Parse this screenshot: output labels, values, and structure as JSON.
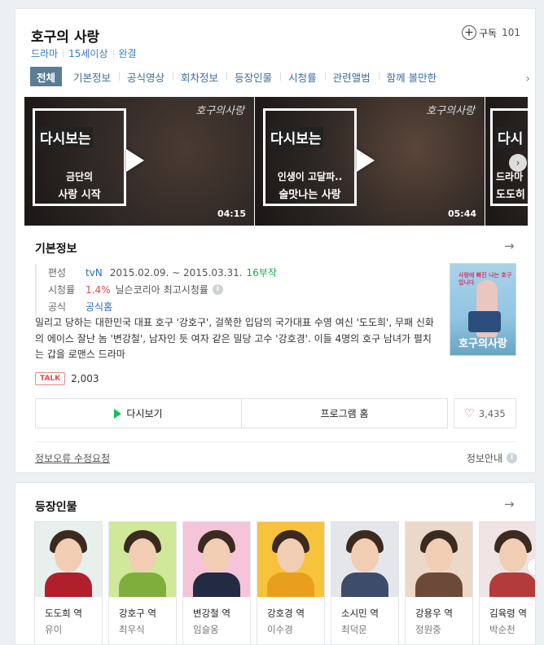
{
  "header": {
    "title": "호구의 사랑",
    "meta": [
      "드라마",
      "15세이상",
      "완결"
    ],
    "subscribe_label": "구독",
    "subscribe_count": "101"
  },
  "tabs": [
    "전체",
    "기본정보",
    "공식영상",
    "회차정보",
    "등장인물",
    "시청률",
    "관련앨범",
    "함께 볼만한"
  ],
  "videos": [
    {
      "brand": "호구의사랑",
      "head": "다시보는",
      "line1": "금단의",
      "line2": "사랑 시작",
      "duration": "04:15",
      "color": "#4a3b33"
    },
    {
      "brand": "호구의사랑",
      "head": "다시보는",
      "line1": "인생이 고달파..",
      "line2": "술맛나는 사랑",
      "duration": "05:44",
      "color": "#5b4639"
    },
    {
      "brand": "",
      "head": "다시",
      "line1": "드라마",
      "line2": "도도히",
      "duration": "",
      "color": "#3f3a3d"
    }
  ],
  "basic_info": {
    "title": "기본정보",
    "broadcast_label": "편성",
    "channel": "tvN",
    "period": "2015.02.09. ~ 2015.03.31.",
    "episodes": "16부작",
    "rating_label": "시청률",
    "rating": "1.4%",
    "rating_source": "닐슨코리아",
    "rating_note": "최고시청률",
    "official_label": "공식",
    "official_link": "공식홈",
    "poster_text": "사랑에 빠진 나는 호구 입니다",
    "poster_logo": "호구의사랑",
    "description": "밀리고 당하는 대한민국 대표 호구 '강호구', 걸쭉한 입담의 국가대표 수영 여신 '도도희', 무패 신화의 에이스 잘난 놈 '변강철', 남자인 듯 여자 같은 밀당 고수 '강호경'. 이들 4명의 호구 남녀가 펼치는 갑을 로맨스 드라마",
    "talk_badge": "TALK",
    "talk_count": "2,003",
    "rewatch_label": "다시보기",
    "program_home_label": "프로그램 홈",
    "like_count": "3,435",
    "report_label": "정보오류 수정요청",
    "guide_label": "정보안내"
  },
  "characters": {
    "title": "등장인물",
    "list": [
      {
        "role": "도도희 역",
        "actor": "유이",
        "bg": "#e8f0ee",
        "body": "#b0202c"
      },
      {
        "role": "강호구 역",
        "actor": "최우식",
        "bg": "#cfe89a",
        "body": "#7fae3c"
      },
      {
        "role": "변강철 역",
        "actor": "임슬옹",
        "bg": "#f6c4d8",
        "body": "#222a44"
      },
      {
        "role": "강호경 역",
        "actor": "이수경",
        "bg": "#f7c23c",
        "body": "#e8a01c"
      },
      {
        "role": "소시민 역",
        "actor": "최덕문",
        "bg": "#e4e6ea",
        "body": "#3d4c6a"
      },
      {
        "role": "강용우 역",
        "actor": "정원중",
        "bg": "#ecd8c8",
        "body": "#6b4a3a"
      },
      {
        "role": "김육령 역",
        "actor": "박순천",
        "bg": "#efe3e3",
        "body": "#b33b3b"
      }
    ]
  }
}
